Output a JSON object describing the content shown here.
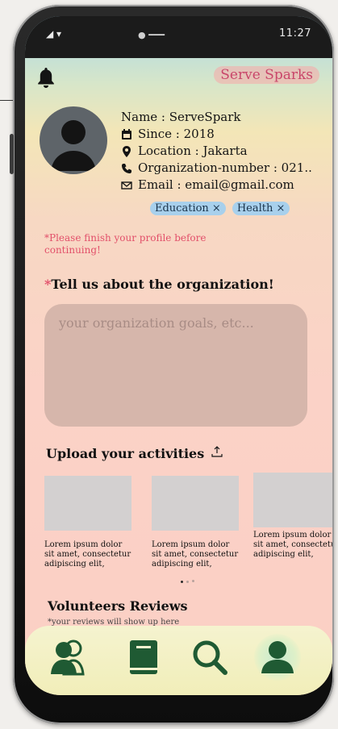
{
  "status_bar": {
    "left": "◢ ▾",
    "middle": "● ━━━",
    "time": "11:27"
  },
  "header": {
    "brand": "Serve Sparks"
  },
  "profile": {
    "name": "Name : ServeSpark",
    "since": "Since : 2018",
    "location": "Location : Jakarta",
    "org_number": "Organization-number : 021..",
    "email": "Email : email@gmail.com",
    "tags": [
      "Education ×",
      "Health ×"
    ]
  },
  "warning": "*Please finish your profile before continuing!",
  "question": {
    "star": "*",
    "text": "Tell us about the organization!"
  },
  "textarea": {
    "placeholder": "your organization goals, etc..."
  },
  "uploads": {
    "title": "Upload your activities",
    "items": [
      {
        "caption": "Lorem ipsum dolor sit amet, consectetur adipiscing elit,"
      },
      {
        "caption": "Lorem ipsum dolor sit amet, consectetur adipiscing elit,"
      },
      {
        "caption": "Lorem ipsum dolor sit amet, consectetur adipiscing elit,"
      }
    ],
    "carousel_pages": 3,
    "carousel_active": 1
  },
  "reviews": {
    "title": "Volunteers Reviews",
    "subtitle": "*your reviews will show up here"
  },
  "nav": {
    "items": [
      "people-icon",
      "book-icon",
      "search-icon",
      "profile-icon"
    ],
    "active": "profile-icon"
  },
  "colors": {
    "accent_green": "#1f5a33",
    "brand_pink": "#c9466a",
    "warning_red": "#e2506a",
    "tag_blue": "#a8d0ec"
  }
}
